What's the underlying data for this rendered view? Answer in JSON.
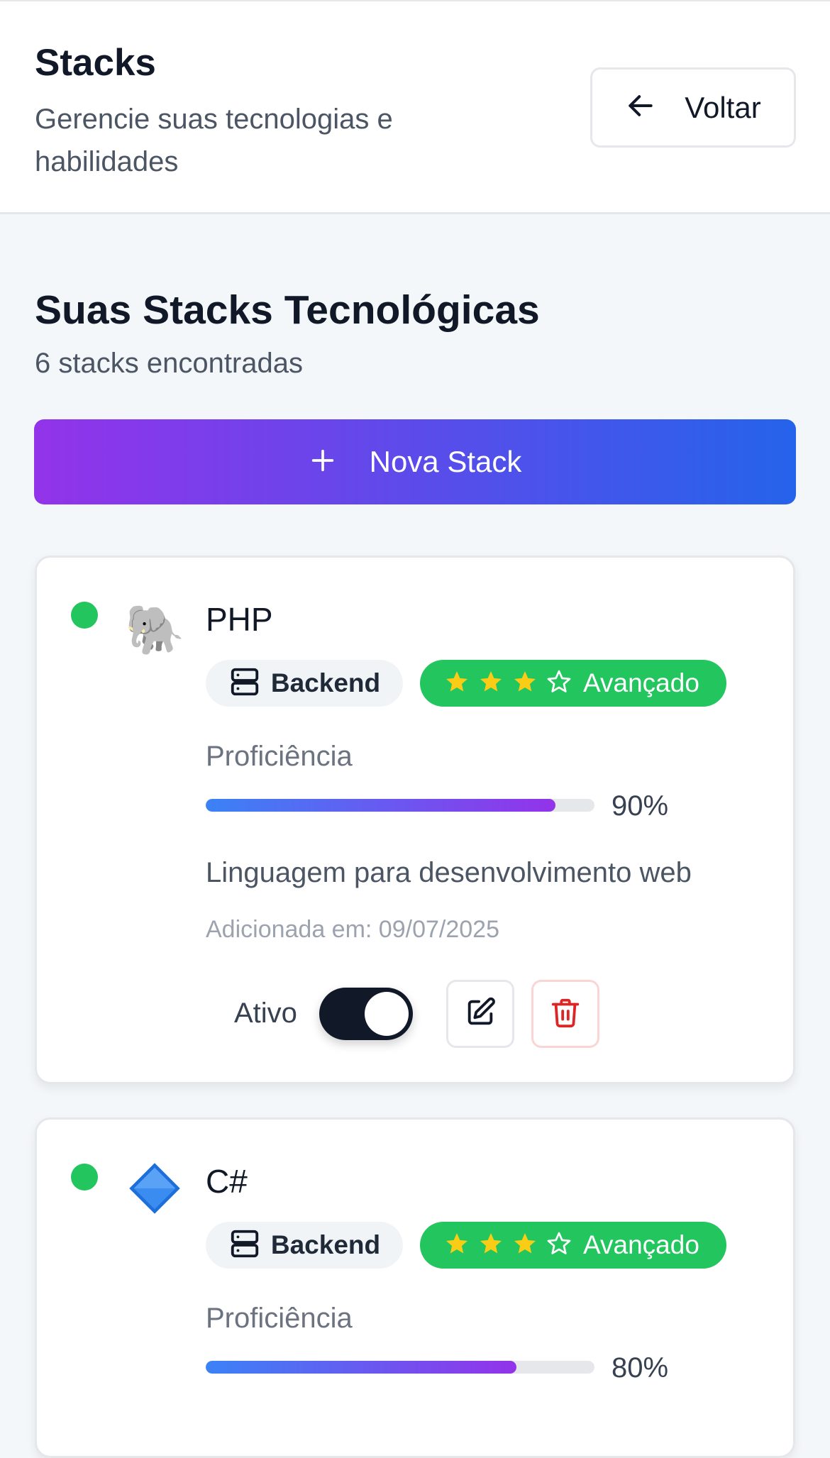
{
  "header": {
    "title": "Stacks",
    "subtitle": "Gerencie suas tecnologias e habilidades",
    "back_label": "Voltar",
    "back_icon": "arrow-left-icon"
  },
  "section": {
    "title": "Suas Stacks Tecnológicas",
    "count": "6 stacks encontradas"
  },
  "new_stack": {
    "label": "Nova Stack",
    "icon": "plus-icon"
  },
  "colors": {
    "status_active": "#22c55e",
    "level_badge": "#22c55e",
    "star": "#facc15",
    "gradient_start": "#9333ea",
    "gradient_end": "#2563eb",
    "delete": "#dc2626",
    "toggle_on": "#111827"
  },
  "stacks": [
    {
      "icon": "🐘",
      "icon_name": "elephant-icon",
      "name": "PHP",
      "category": "Backend",
      "category_icon": "server-icon",
      "level": "Avançado",
      "stars_filled": 3,
      "stars_total": 4,
      "proficiency_label": "Proficiência",
      "proficiency": 90,
      "proficiency_text": "90%",
      "description": "Linguagem para desenvolvimento web",
      "date": "Adicionada em: 09/07/2025",
      "active_label": "Ativo",
      "active": true
    },
    {
      "icon": "🔷",
      "icon_name": "blue-diamond-icon",
      "name": "C#",
      "category": "Backend",
      "category_icon": "server-icon",
      "level": "Avançado",
      "stars_filled": 3,
      "stars_total": 4,
      "proficiency_label": "Proficiência",
      "proficiency": 80,
      "proficiency_text": "80%"
    }
  ]
}
